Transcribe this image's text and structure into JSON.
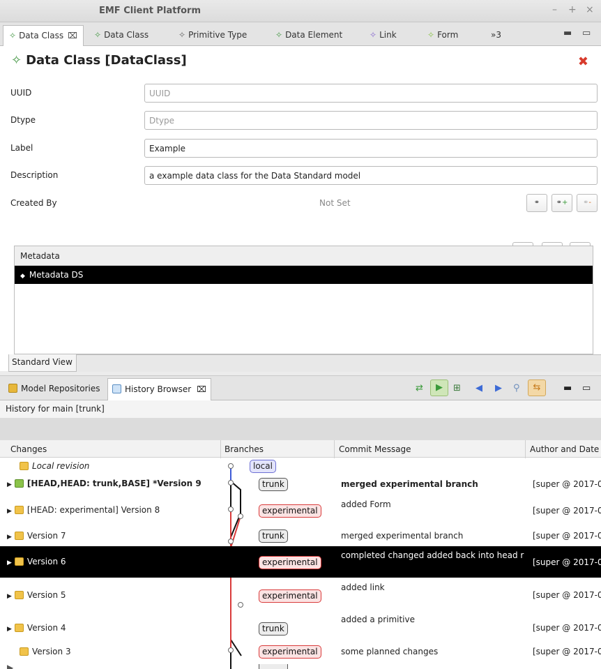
{
  "window": {
    "title": "EMF Client Platform"
  },
  "editor_tabs": [
    {
      "label": "Data Class",
      "active": true,
      "close": "⌧"
    },
    {
      "label": "Data Class"
    },
    {
      "label": "Primitive Type"
    },
    {
      "label": "Data Element"
    },
    {
      "label": "Link"
    },
    {
      "label": "Form"
    },
    {
      "label": "»3"
    }
  ],
  "editor": {
    "heading": "Data Class [DataClass]",
    "fields": [
      {
        "label": "UUID",
        "value": "",
        "placeholder": "UUID"
      },
      {
        "label": "Dtype",
        "value": "",
        "placeholder": "Dtype"
      },
      {
        "label": "Label",
        "value": "Example",
        "placeholder": ""
      },
      {
        "label": "Description",
        "value": "a example data class for the Data Standard model",
        "placeholder": ""
      }
    ],
    "created_by": {
      "label": "Created By",
      "value": "Not Set"
    },
    "metadata": {
      "header": "Metadata",
      "items": [
        "Metadata DS"
      ]
    },
    "standard_view_tab": "Standard View"
  },
  "views": {
    "tabs": [
      {
        "label": "Model Repositories"
      },
      {
        "label": "History Browser",
        "active": true,
        "close": "⌧"
      }
    ]
  },
  "history": {
    "subtitle": "History for main [trunk]",
    "columns": [
      "Changes",
      "Branches",
      "Commit Message",
      "Author and Date"
    ],
    "rows": [
      {
        "change": "Local revision",
        "branch": "local",
        "message": "",
        "author": ""
      },
      {
        "change": "[HEAD,HEAD: trunk,BASE] *Version 9",
        "branch": "trunk",
        "message": "merged experimental branch",
        "author": "[super @ 2017-0"
      },
      {
        "change": "[HEAD: experimental] Version 8",
        "branch": "experimental",
        "message": "added Form",
        "author": "[super @ 2017-0"
      },
      {
        "change": "Version 7",
        "branch": "trunk",
        "message": "merged experimental branch",
        "author": "[super @ 2017-0"
      },
      {
        "change": "Version 6",
        "branch": "experimental",
        "message": "completed changed added back into head r",
        "author": "[super @ 2017-0"
      },
      {
        "change": "Version 5",
        "branch": "experimental",
        "message": "added link",
        "author": "[super @ 2017-0"
      },
      {
        "change": "Version 4",
        "branch": "trunk",
        "message": "added a primitive",
        "author": "[super @ 2017-0"
      },
      {
        "change": "Version 3",
        "branch": "experimental",
        "message": "some planned changes",
        "author": "[super @ 2017-0"
      }
    ]
  },
  "colors": {
    "trunk_line": "#111111",
    "experimental_line": "#d93a3a",
    "local_line": "#3d5bd6",
    "selection": "#000000"
  }
}
